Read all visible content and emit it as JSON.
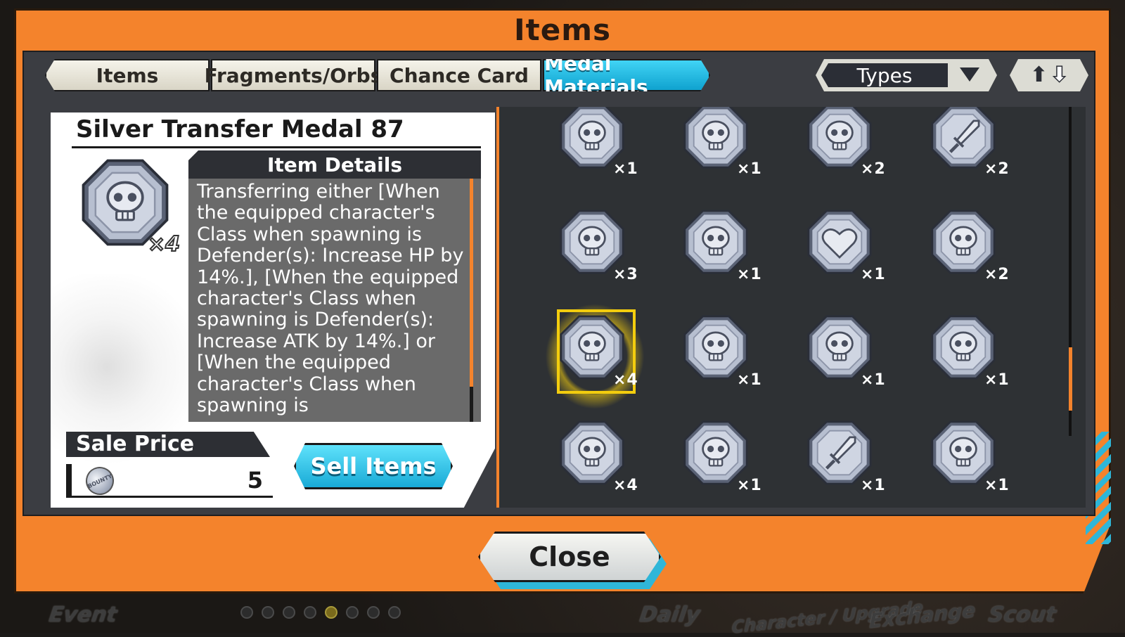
{
  "window": {
    "title": "Items"
  },
  "tabs": [
    {
      "label": "Items",
      "active": false
    },
    {
      "label": "Fragments/Orbs",
      "active": false
    },
    {
      "label": "Chance Card",
      "active": false
    },
    {
      "label": "Medal Materials",
      "active": true
    }
  ],
  "filter": {
    "label": "Types",
    "icon": "chevron-down-icon"
  },
  "sort": {
    "icon": "sort-up-down-icon"
  },
  "selected_item": {
    "name": "Silver Transfer Medal 87",
    "icon": "skull-medal-icon",
    "count": "×4",
    "details_title": "Item Details",
    "description": "Transferring either [When the equipped character's Class when spawning is Defender(s): Increase HP by 14%.], [When the equipped character's Class when spawning is Defender(s): Increase ATK by 14%.] or [When the equipped character's Class when spawning is",
    "sale_price_label": "Sale Price",
    "sale_price_value": "5",
    "currency_icon": "bounty-coin-icon",
    "currency_text": "BOUNTY"
  },
  "sell_button": {
    "label": "Sell Items"
  },
  "close_button": {
    "label": "Close"
  },
  "medals": [
    {
      "icon": "skull",
      "count": "×1",
      "selected": false
    },
    {
      "icon": "skull",
      "count": "×1",
      "selected": false
    },
    {
      "icon": "skull",
      "count": "×2",
      "selected": false
    },
    {
      "icon": "sword",
      "count": "×2",
      "selected": false
    },
    {
      "icon": "skull",
      "count": "×3",
      "selected": false
    },
    {
      "icon": "skull",
      "count": "×1",
      "selected": false
    },
    {
      "icon": "heart",
      "count": "×1",
      "selected": false
    },
    {
      "icon": "skull",
      "count": "×2",
      "selected": false
    },
    {
      "icon": "skull",
      "count": "×4",
      "selected": true
    },
    {
      "icon": "skull",
      "count": "×1",
      "selected": false
    },
    {
      "icon": "skull",
      "count": "×1",
      "selected": false
    },
    {
      "icon": "skull",
      "count": "×1",
      "selected": false
    },
    {
      "icon": "skull",
      "count": "×4",
      "selected": false
    },
    {
      "icon": "skull",
      "count": "×1",
      "selected": false
    },
    {
      "icon": "sword",
      "count": "×1",
      "selected": false
    },
    {
      "icon": "skull",
      "count": "×1",
      "selected": false
    }
  ],
  "bottom_nav": [
    {
      "label": "Event"
    },
    {
      "label": "Daily"
    },
    {
      "label": "Character / Upgrade"
    },
    {
      "label": "Exchange"
    },
    {
      "label": "Scout"
    }
  ],
  "page_dots": {
    "total": 8,
    "active_index": 4
  },
  "colors": {
    "frame": "#f4832c",
    "accent": "#19aad6",
    "selection": "#f3cd0e",
    "panel": "#2e3134"
  }
}
